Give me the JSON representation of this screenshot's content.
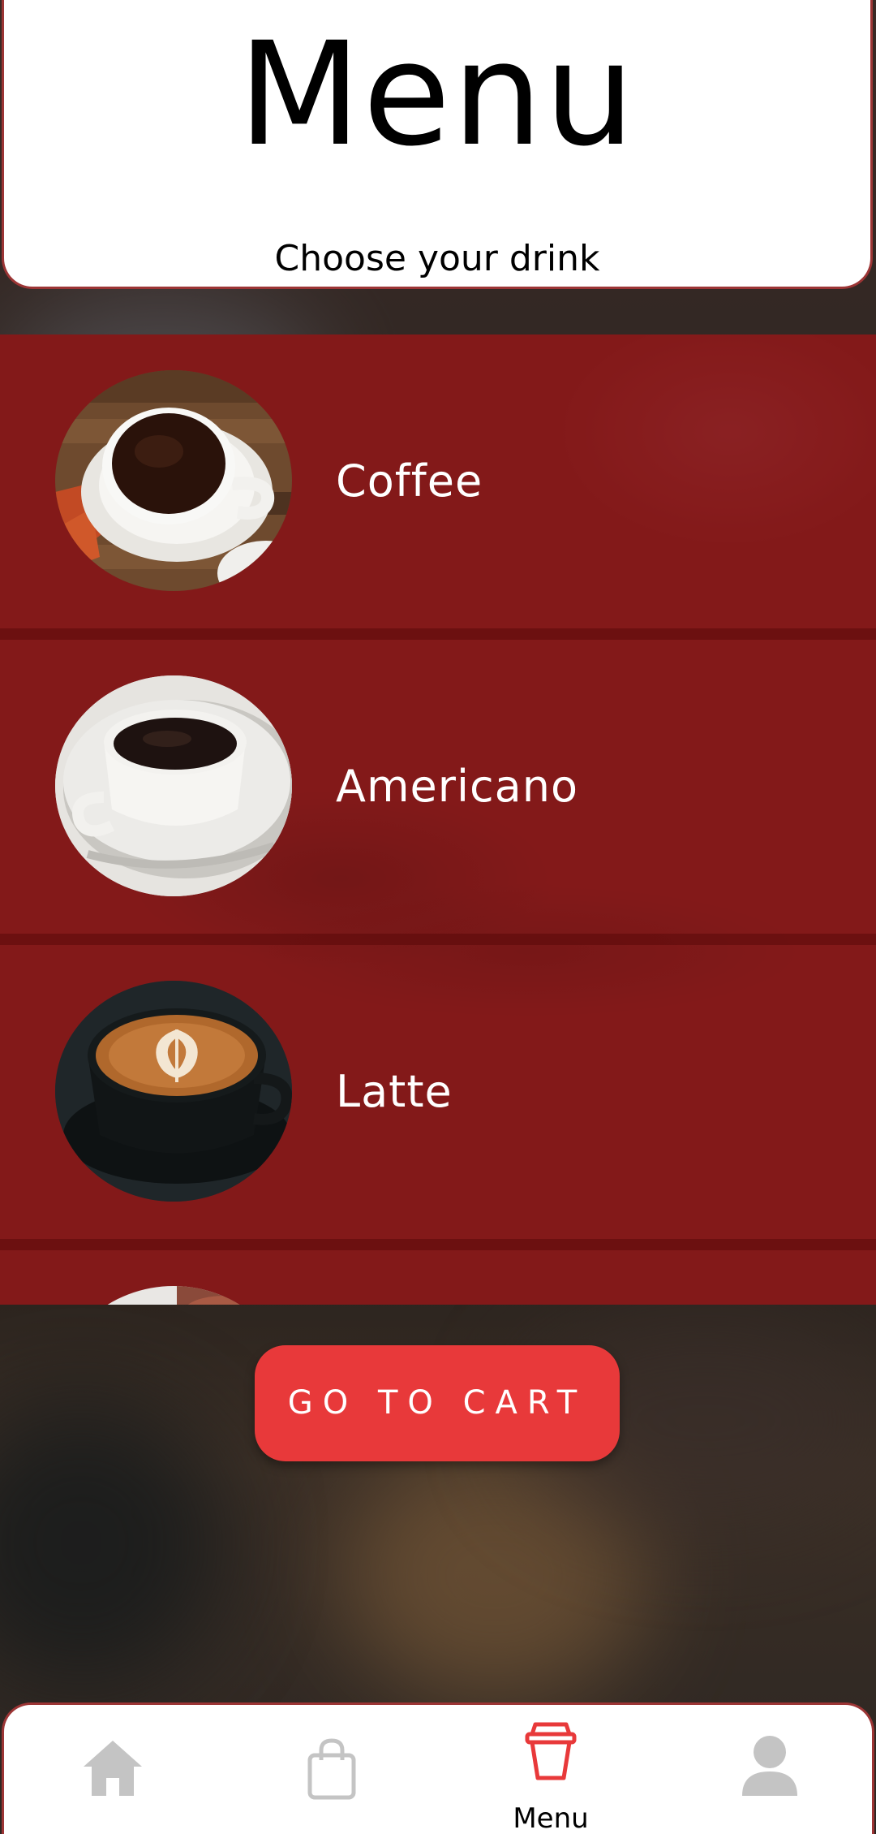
{
  "header": {
    "title": "Menu",
    "subtitle": "Choose your drink"
  },
  "menu": {
    "items": [
      {
        "label": "Coffee",
        "image": "coffee-cup-photo"
      },
      {
        "label": "Americano",
        "image": "americano-cup-photo"
      },
      {
        "label": "Latte",
        "image": "latte-cup-photo"
      },
      {
        "label": "",
        "image": "partial-drink-photo"
      }
    ]
  },
  "cart": {
    "label": "GO TO CART"
  },
  "nav": {
    "items": [
      {
        "icon": "home-icon",
        "label": "",
        "active": false
      },
      {
        "icon": "shopping-bag-icon",
        "label": "",
        "active": false
      },
      {
        "icon": "cup-icon",
        "label": "Menu",
        "active": true
      },
      {
        "icon": "person-icon",
        "label": "",
        "active": false
      }
    ]
  },
  "colors": {
    "accent": "#e8393a",
    "header_border": "#9c3535",
    "list_background": "#7d1515",
    "inactive_icon": "#c4c4c4"
  }
}
